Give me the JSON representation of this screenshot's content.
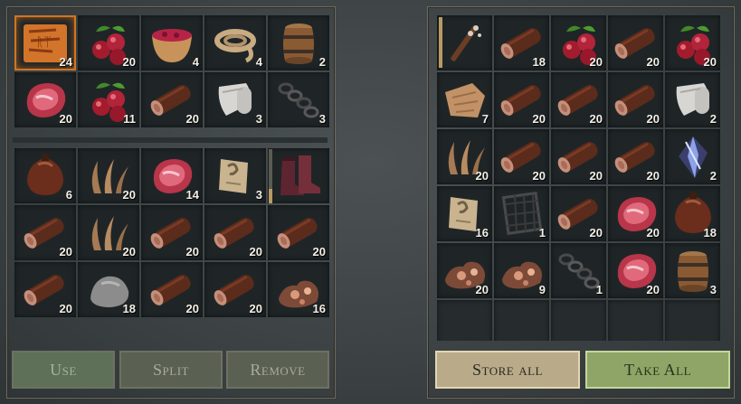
{
  "left_inventory": {
    "rows": [
      [
        {
          "item": "treasure-map",
          "qty": "24",
          "selected": true
        },
        {
          "item": "berries",
          "qty": "20"
        },
        {
          "item": "berry-bowl",
          "qty": "4"
        },
        {
          "item": "rope",
          "qty": "4"
        },
        {
          "item": "barrel",
          "qty": "2"
        }
      ],
      [
        {
          "item": "raw-meat",
          "qty": "20"
        },
        {
          "item": "berries",
          "qty": "11"
        },
        {
          "item": "log",
          "qty": "20"
        },
        {
          "item": "cloth",
          "qty": "3"
        },
        {
          "item": "chain",
          "qty": "3"
        }
      ],
      [
        {
          "item": "waterskin",
          "qty": "6"
        },
        {
          "item": "plant-fiber",
          "qty": "20"
        },
        {
          "item": "raw-meat",
          "qty": "14"
        },
        {
          "item": "note",
          "qty": "3"
        },
        {
          "item": "boots",
          "qty": ""
        }
      ],
      [
        {
          "item": "log",
          "qty": "20"
        },
        {
          "item": "plant-fiber",
          "qty": "20"
        },
        {
          "item": "log",
          "qty": "20"
        },
        {
          "item": "log",
          "qty": "20"
        },
        {
          "item": "log",
          "qty": "20"
        }
      ],
      [
        {
          "item": "log",
          "qty": "20"
        },
        {
          "item": "stone",
          "qty": "18"
        },
        {
          "item": "log",
          "qty": "20"
        },
        {
          "item": "log",
          "qty": "20"
        },
        {
          "item": "copper-ore",
          "qty": "16"
        }
      ]
    ],
    "buttons": {
      "use": "Use",
      "split": "Split",
      "remove": "Remove"
    }
  },
  "right_inventory": {
    "rows": [
      [
        {
          "item": "spiked-club",
          "qty": ""
        },
        {
          "item": "log",
          "qty": "18"
        },
        {
          "item": "berries",
          "qty": "20"
        },
        {
          "item": "log",
          "qty": "20"
        },
        {
          "item": "berries",
          "qty": "20"
        }
      ],
      [
        {
          "item": "leather-scrap",
          "qty": "7"
        },
        {
          "item": "log",
          "qty": "20"
        },
        {
          "item": "log",
          "qty": "20"
        },
        {
          "item": "log",
          "qty": "20"
        },
        {
          "item": "cloth",
          "qty": "2"
        }
      ],
      [
        {
          "item": "plant-fiber",
          "qty": "20"
        },
        {
          "item": "log",
          "qty": "20"
        },
        {
          "item": "log",
          "qty": "20"
        },
        {
          "item": "log",
          "qty": "20"
        },
        {
          "item": "crystal",
          "qty": "2"
        }
      ],
      [
        {
          "item": "note",
          "qty": "16"
        },
        {
          "item": "net",
          "qty": "1"
        },
        {
          "item": "log",
          "qty": "20"
        },
        {
          "item": "raw-meat",
          "qty": "20"
        },
        {
          "item": "waterskin",
          "qty": "18"
        }
      ],
      [
        {
          "item": "copper-ore",
          "qty": "20"
        },
        {
          "item": "copper-ore",
          "qty": "9"
        },
        {
          "item": "chain",
          "qty": "1"
        },
        {
          "item": "raw-meat",
          "qty": "20"
        },
        {
          "item": "barrel",
          "qty": "3"
        }
      ]
    ],
    "buttons": {
      "store_all": "Store all",
      "take_all": "Take All"
    }
  }
}
